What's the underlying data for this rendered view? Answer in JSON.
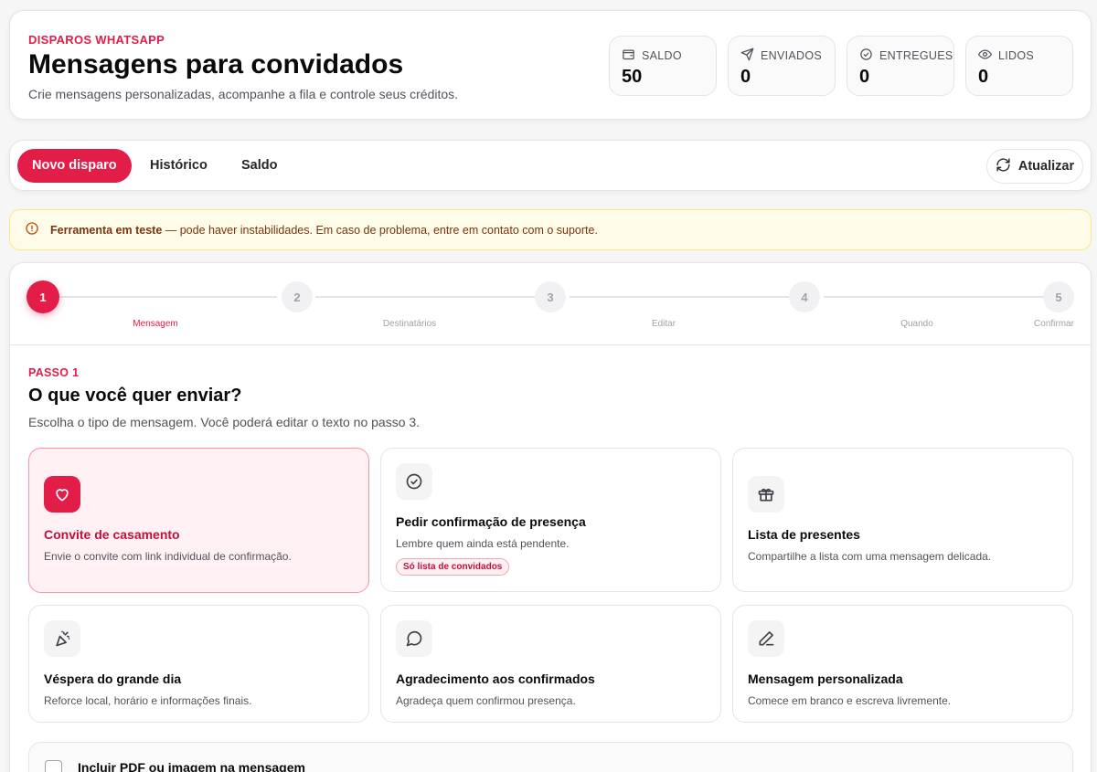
{
  "header": {
    "eyebrow": "DISPAROS WHATSAPP",
    "title": "Mensagens para convidados",
    "subtitle": "Crie mensagens personalizadas, acompanhe a fila e controle seus créditos.",
    "stats": [
      {
        "label": "SALDO",
        "value": "50",
        "icon": "wallet-icon"
      },
      {
        "label": "ENVIADOS",
        "value": "0",
        "icon": "send-icon"
      },
      {
        "label": "ENTREGUES",
        "value": "0",
        "icon": "check-circle-icon"
      },
      {
        "label": "LIDOS",
        "value": "0",
        "icon": "eye-icon"
      }
    ]
  },
  "tabs": {
    "items": [
      "Novo disparo",
      "Histórico",
      "Saldo"
    ],
    "active": "Novo disparo",
    "refresh_label": "Atualizar"
  },
  "warning": {
    "bold": "Ferramenta em teste",
    "text": " — pode haver instabilidades. Em caso de problema, entre em contato com o suporte."
  },
  "stepper": {
    "steps": [
      {
        "number": "1",
        "label": "Mensagem"
      },
      {
        "number": "2",
        "label": "Destinatários"
      },
      {
        "number": "3",
        "label": "Editar"
      },
      {
        "number": "4",
        "label": "Quando"
      },
      {
        "number": "5",
        "label": "Confirmar"
      }
    ],
    "current": 1
  },
  "step_content": {
    "step_label": "PASSO 1",
    "title": "O que você quer enviar?",
    "description": "Escolha o tipo de mensagem. Você poderá editar o texto no passo 3.",
    "options": [
      {
        "title": "Convite de casamento",
        "description": "Envie o convite com link individual de confirmação.",
        "icon": "heart-icon",
        "selected": true
      },
      {
        "title": "Pedir confirmação de presença",
        "description": "Lembre quem ainda está pendente.",
        "icon": "check-circle-icon",
        "badge": "Só lista de convidados"
      },
      {
        "title": "Lista de presentes",
        "description": "Compartilhe a lista com uma mensagem delicada.",
        "icon": "gift-icon"
      },
      {
        "title": "Véspera do grande dia",
        "description": "Reforce local, horário e informações finais.",
        "icon": "party-popper-icon"
      },
      {
        "title": "Agradecimento aos confirmados",
        "description": "Agradeça quem confirmou presença.",
        "icon": "message-circle-icon"
      },
      {
        "title": "Mensagem personalizada",
        "description": "Comece em branco e escreva livremente.",
        "icon": "pencil-icon"
      }
    ],
    "attachment_label": "Incluir PDF ou imagem na mensagem"
  },
  "colors": {
    "accent": "#e11d48",
    "warning_bg": "#fefbe8",
    "warning_text": "#78350f"
  }
}
